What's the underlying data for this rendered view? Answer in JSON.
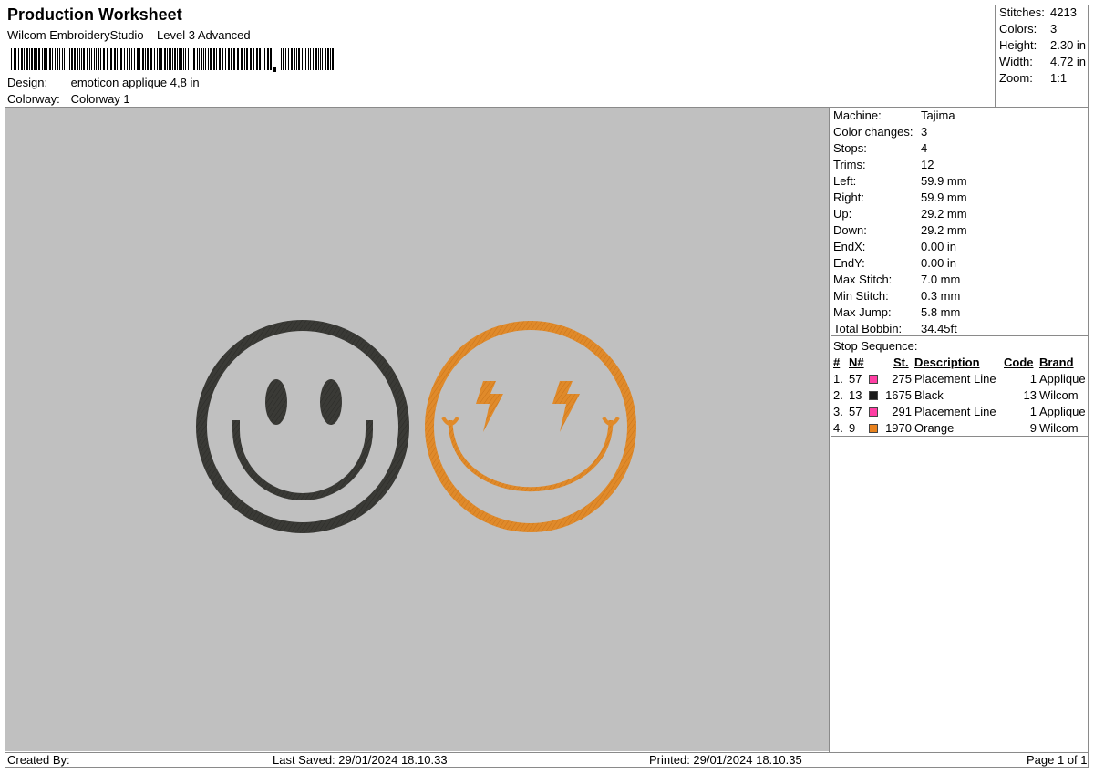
{
  "header": {
    "title": "Production Worksheet",
    "software": "Wilcom EmbroideryStudio – Level 3 Advanced",
    "design_label": "Design:",
    "design_value": "emoticon applique 4,8 in",
    "colorway_label": "Colorway:",
    "colorway_value": "Colorway 1"
  },
  "summary": {
    "stitches_label": "Stitches:",
    "stitches": "4213",
    "colors_label": "Colors:",
    "colors": "3",
    "height_label": "Height:",
    "height": "2.30 in",
    "width_label": "Width:",
    "width": "4.72 in",
    "zoom_label": "Zoom:",
    "zoom": "1:1"
  },
  "specs": [
    {
      "label": "Machine:",
      "value": "Tajima"
    },
    {
      "label": "Color changes:",
      "value": "3"
    },
    {
      "label": "Stops:",
      "value": "4"
    },
    {
      "label": "Trims:",
      "value": "12"
    },
    {
      "label": "Left:",
      "value": "59.9 mm"
    },
    {
      "label": "Right:",
      "value": "59.9 mm"
    },
    {
      "label": "Up:",
      "value": "29.2 mm"
    },
    {
      "label": "Down:",
      "value": "29.2 mm"
    },
    {
      "label": "EndX:",
      "value": "0.00 in"
    },
    {
      "label": "EndY:",
      "value": "0.00 in"
    },
    {
      "label": "Max Stitch:",
      "value": "7.0 mm"
    },
    {
      "label": "Min Stitch:",
      "value": "0.3 mm"
    },
    {
      "label": "Max Jump:",
      "value": "5.8 mm"
    },
    {
      "label": "Total Bobbin:",
      "value": "34.45ft"
    }
  ],
  "stop_sequence": {
    "title": "Stop Sequence:",
    "headers": {
      "num": "#",
      "n": "N#",
      "st": "St.",
      "description": "Description",
      "code": "Code",
      "brand": "Brand"
    },
    "rows": [
      {
        "num": "1.",
        "n": "57",
        "color": "#ff3fa4",
        "st": "275",
        "description": "Placement Line",
        "code": "1",
        "brand": "Applique"
      },
      {
        "num": "2.",
        "n": "13",
        "color": "#1a1a1a",
        "st": "1675",
        "description": "Black",
        "code": "13",
        "brand": "Wilcom"
      },
      {
        "num": "3.",
        "n": "57",
        "color": "#ff3fa4",
        "st": "291",
        "description": "Placement Line",
        "code": "1",
        "brand": "Applique"
      },
      {
        "num": "4.",
        "n": "9",
        "color": "#e8821e",
        "st": "1970",
        "description": "Orange",
        "code": "9",
        "brand": "Wilcom"
      }
    ]
  },
  "design_colors": {
    "canvas": "#c0c0c0",
    "black_thread": "#3a3a36",
    "orange_thread": "#e08a2a"
  },
  "footer": {
    "created_by": "Created By:",
    "last_saved": "Last Saved: 29/01/2024 18.10.33",
    "printed": "Printed: 29/01/2024 18.10.35",
    "page": "Page 1 of 1"
  }
}
